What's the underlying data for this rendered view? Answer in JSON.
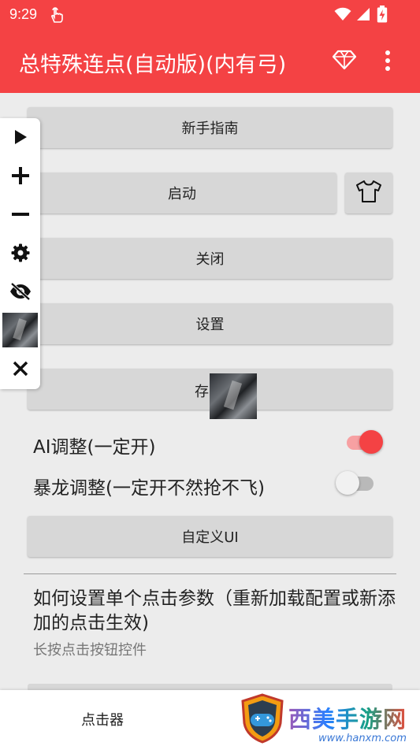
{
  "status_bar": {
    "time": "9:29"
  },
  "app_bar": {
    "title": "总特殊连点(自动版)(内有弓)"
  },
  "buttons": {
    "guide": "新手指南",
    "start": "启动",
    "close": "关闭",
    "settings": "设置",
    "save": "存",
    "custom_ui": "自定义UI"
  },
  "toggles": [
    {
      "label": "AI调整(一定开)",
      "on": true
    },
    {
      "label": "暴龙调整(一定开不然抢不飞)",
      "on": false
    }
  ],
  "info": {
    "title": "如何设置单个点击参数（重新加载配置或新添加的点击生效)",
    "subtitle": "长按点击按钮控件"
  },
  "bottom_nav": {
    "tab_label": "点击器"
  },
  "watermark": {
    "text": "西美手游网",
    "url": "www.hanxm.com"
  },
  "colors": {
    "accent": "#f44244",
    "button": "#d7d7d7",
    "switch_on_track": "#f7a0a2",
    "switch_off_track": "#b9b9b9"
  },
  "icons": [
    "hand-touch-icon",
    "wifi-icon",
    "signal-icon",
    "battery-charging-icon",
    "diamond-icon",
    "more-vert-icon",
    "shirt-icon",
    "play-icon",
    "plus-icon",
    "minus-icon",
    "gear-icon",
    "eye-off-icon",
    "close-icon",
    "gamepad-shield-icon"
  ]
}
